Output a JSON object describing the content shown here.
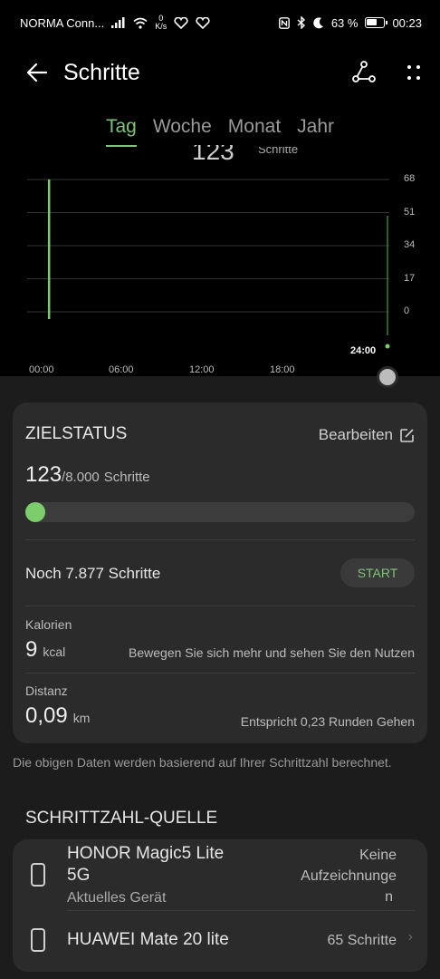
{
  "status_bar": {
    "carrier": "NORMA Conn...",
    "net_speed_value": "0",
    "net_speed_unit": "K/s",
    "battery_percent": "63 %",
    "time": "00:23"
  },
  "header": {
    "title": "Schritte"
  },
  "tabs": [
    {
      "label": "Tag",
      "active": true
    },
    {
      "label": "Woche",
      "active": false
    },
    {
      "label": "Monat",
      "active": false
    },
    {
      "label": "Jahr",
      "active": false
    }
  ],
  "chart_data": {
    "type": "bar",
    "ylim": [
      0,
      68
    ],
    "yticks": [
      "68",
      "51",
      "34",
      "17",
      "0"
    ],
    "xticks": [
      "00:00",
      "06:00",
      "12:00",
      "18:00"
    ],
    "x_marker": "24:00",
    "bars": [
      {
        "time_hours": 0.4,
        "value": 68
      }
    ],
    "partial_value": "123",
    "partial_unit": "Schritte",
    "colors": {
      "bar": "#7ccd6b",
      "grid": "#333333"
    }
  },
  "goal": {
    "header": "ZIELSTATUS",
    "edit_label": "Bearbeiten",
    "current": "123",
    "goal": "/8.000",
    "unit": "Schritte",
    "progress_fraction": 0.015,
    "remaining": "Noch 7.877 Schritte",
    "start_label": "START",
    "calories_label": "Kalorien",
    "calories_value": "9",
    "calories_unit": "kcal",
    "calories_hint": "Bewegen Sie sich mehr und sehen Sie den Nutzen",
    "distance_label": "Distanz",
    "distance_value": "0,09",
    "distance_unit": "km",
    "distance_hint": "Entspricht 0,23 Runden Gehen"
  },
  "footnote": "Die obigen Daten werden basierend auf Ihrer Schrittzahl berechnet.",
  "source": {
    "section_title": "SCHRITTZAHL-QUELLE",
    "devices": [
      {
        "name_line1": "HONOR Magic5 Lite",
        "name_line2": "5G",
        "subtitle": "Aktuelles Gerät",
        "status_line1": "Keine",
        "status_line2": "Aufzeichnunge",
        "status_line3": "n"
      },
      {
        "name_line1": "HUAWEI Mate 20 lite",
        "status_line1": "65 Schritte"
      }
    ]
  }
}
